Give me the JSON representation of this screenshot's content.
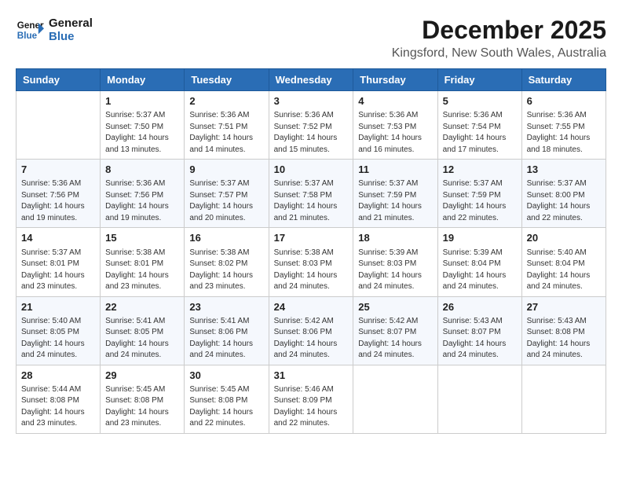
{
  "logo": {
    "line1": "General",
    "line2": "Blue"
  },
  "title": "December 2025",
  "subtitle": "Kingsford, New South Wales, Australia",
  "headers": [
    "Sunday",
    "Monday",
    "Tuesday",
    "Wednesday",
    "Thursday",
    "Friday",
    "Saturday"
  ],
  "weeks": [
    [
      {
        "day": "",
        "info": ""
      },
      {
        "day": "1",
        "info": "Sunrise: 5:37 AM\nSunset: 7:50 PM\nDaylight: 14 hours\nand 13 minutes."
      },
      {
        "day": "2",
        "info": "Sunrise: 5:36 AM\nSunset: 7:51 PM\nDaylight: 14 hours\nand 14 minutes."
      },
      {
        "day": "3",
        "info": "Sunrise: 5:36 AM\nSunset: 7:52 PM\nDaylight: 14 hours\nand 15 minutes."
      },
      {
        "day": "4",
        "info": "Sunrise: 5:36 AM\nSunset: 7:53 PM\nDaylight: 14 hours\nand 16 minutes."
      },
      {
        "day": "5",
        "info": "Sunrise: 5:36 AM\nSunset: 7:54 PM\nDaylight: 14 hours\nand 17 minutes."
      },
      {
        "day": "6",
        "info": "Sunrise: 5:36 AM\nSunset: 7:55 PM\nDaylight: 14 hours\nand 18 minutes."
      }
    ],
    [
      {
        "day": "7",
        "info": "Sunrise: 5:36 AM\nSunset: 7:56 PM\nDaylight: 14 hours\nand 19 minutes."
      },
      {
        "day": "8",
        "info": "Sunrise: 5:36 AM\nSunset: 7:56 PM\nDaylight: 14 hours\nand 19 minutes."
      },
      {
        "day": "9",
        "info": "Sunrise: 5:37 AM\nSunset: 7:57 PM\nDaylight: 14 hours\nand 20 minutes."
      },
      {
        "day": "10",
        "info": "Sunrise: 5:37 AM\nSunset: 7:58 PM\nDaylight: 14 hours\nand 21 minutes."
      },
      {
        "day": "11",
        "info": "Sunrise: 5:37 AM\nSunset: 7:59 PM\nDaylight: 14 hours\nand 21 minutes."
      },
      {
        "day": "12",
        "info": "Sunrise: 5:37 AM\nSunset: 7:59 PM\nDaylight: 14 hours\nand 22 minutes."
      },
      {
        "day": "13",
        "info": "Sunrise: 5:37 AM\nSunset: 8:00 PM\nDaylight: 14 hours\nand 22 minutes."
      }
    ],
    [
      {
        "day": "14",
        "info": "Sunrise: 5:37 AM\nSunset: 8:01 PM\nDaylight: 14 hours\nand 23 minutes."
      },
      {
        "day": "15",
        "info": "Sunrise: 5:38 AM\nSunset: 8:01 PM\nDaylight: 14 hours\nand 23 minutes."
      },
      {
        "day": "16",
        "info": "Sunrise: 5:38 AM\nSunset: 8:02 PM\nDaylight: 14 hours\nand 23 minutes."
      },
      {
        "day": "17",
        "info": "Sunrise: 5:38 AM\nSunset: 8:03 PM\nDaylight: 14 hours\nand 24 minutes."
      },
      {
        "day": "18",
        "info": "Sunrise: 5:39 AM\nSunset: 8:03 PM\nDaylight: 14 hours\nand 24 minutes."
      },
      {
        "day": "19",
        "info": "Sunrise: 5:39 AM\nSunset: 8:04 PM\nDaylight: 14 hours\nand 24 minutes."
      },
      {
        "day": "20",
        "info": "Sunrise: 5:40 AM\nSunset: 8:04 PM\nDaylight: 14 hours\nand 24 minutes."
      }
    ],
    [
      {
        "day": "21",
        "info": "Sunrise: 5:40 AM\nSunset: 8:05 PM\nDaylight: 14 hours\nand 24 minutes."
      },
      {
        "day": "22",
        "info": "Sunrise: 5:41 AM\nSunset: 8:05 PM\nDaylight: 14 hours\nand 24 minutes."
      },
      {
        "day": "23",
        "info": "Sunrise: 5:41 AM\nSunset: 8:06 PM\nDaylight: 14 hours\nand 24 minutes."
      },
      {
        "day": "24",
        "info": "Sunrise: 5:42 AM\nSunset: 8:06 PM\nDaylight: 14 hours\nand 24 minutes."
      },
      {
        "day": "25",
        "info": "Sunrise: 5:42 AM\nSunset: 8:07 PM\nDaylight: 14 hours\nand 24 minutes."
      },
      {
        "day": "26",
        "info": "Sunrise: 5:43 AM\nSunset: 8:07 PM\nDaylight: 14 hours\nand 24 minutes."
      },
      {
        "day": "27",
        "info": "Sunrise: 5:43 AM\nSunset: 8:08 PM\nDaylight: 14 hours\nand 24 minutes."
      }
    ],
    [
      {
        "day": "28",
        "info": "Sunrise: 5:44 AM\nSunset: 8:08 PM\nDaylight: 14 hours\nand 23 minutes."
      },
      {
        "day": "29",
        "info": "Sunrise: 5:45 AM\nSunset: 8:08 PM\nDaylight: 14 hours\nand 23 minutes."
      },
      {
        "day": "30",
        "info": "Sunrise: 5:45 AM\nSunset: 8:08 PM\nDaylight: 14 hours\nand 22 minutes."
      },
      {
        "day": "31",
        "info": "Sunrise: 5:46 AM\nSunset: 8:09 PM\nDaylight: 14 hours\nand 22 minutes."
      },
      {
        "day": "",
        "info": ""
      },
      {
        "day": "",
        "info": ""
      },
      {
        "day": "",
        "info": ""
      }
    ]
  ]
}
